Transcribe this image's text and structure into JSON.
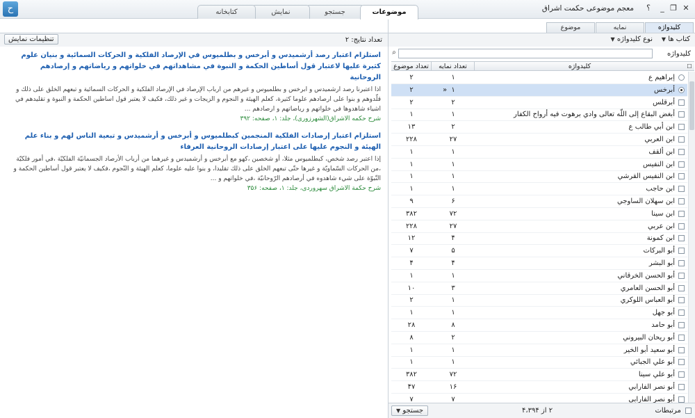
{
  "titlebar": {
    "app_title": "معجم موضوعی حکمت اشراق",
    "help": "؟",
    "logo": "ح",
    "tabs": [
      "کتابخانه",
      "نمایش",
      "جستجو",
      "موضوعات"
    ],
    "active_tab": "موضوعات",
    "buttons": {
      "minimize": "_",
      "restore": "❐",
      "close": "✕"
    }
  },
  "right_panel": {
    "subtabs": [
      "موضوع",
      "نمایه",
      "کلیدواژه"
    ],
    "active_subtab": "کلیدواژه",
    "toolbar": {
      "books": "کتاب ها",
      "keyword_type": "نوع کلیدواژه"
    },
    "search": {
      "label": "کلیدواژه",
      "value": "",
      "placeholder": ""
    },
    "columns": {
      "topic_count": "تعداد موضوع",
      "index_count": "تعداد نمایه",
      "keyword": "کلیدواژه"
    },
    "rows": [
      {
        "kw": "إبراهيم ع",
        "rep": "۱",
        "topic": "۲",
        "sel": false,
        "radio": true
      },
      {
        "kw": "أبرخس",
        "rep": "۱",
        "topic": "۲",
        "sel": true,
        "radio": true
      },
      {
        "kw": "أبرقلس",
        "rep": "۲",
        "topic": "۲",
        "sel": false,
        "radio": false
      },
      {
        "kw": "أبغض البقاع إلى اللّه تعالی وادي برهوت فيه أرواح الكفار",
        "rep": "۱",
        "topic": "۱",
        "sel": false,
        "radio": false
      },
      {
        "kw": "ابن أبي طالب ع",
        "rep": "۲",
        "topic": "۱۳",
        "sel": false,
        "radio": false
      },
      {
        "kw": "ابن العربي",
        "rep": "۲۷",
        "topic": "۲۲۸",
        "sel": false,
        "radio": false
      },
      {
        "kw": "ابن ألقف",
        "rep": "۱",
        "topic": "۱",
        "sel": false,
        "radio": false
      },
      {
        "kw": "ابن النفيس",
        "rep": "۱",
        "topic": "۱",
        "sel": false,
        "radio": false
      },
      {
        "kw": "ابن النفيس القرشي",
        "rep": "۱",
        "topic": "۱",
        "sel": false,
        "radio": false
      },
      {
        "kw": "ابن حاجب",
        "rep": "۱",
        "topic": "۱",
        "sel": false,
        "radio": false
      },
      {
        "kw": "ابن سهلان الساوجي",
        "rep": "۶",
        "topic": "۹",
        "sel": false,
        "radio": false
      },
      {
        "kw": "ابن سينا",
        "rep": "۷۲",
        "topic": "۳۸۲",
        "sel": false,
        "radio": false
      },
      {
        "kw": "ابن عربي",
        "rep": "۲۷",
        "topic": "۲۲۸",
        "sel": false,
        "radio": false
      },
      {
        "kw": "ابن كمونة",
        "rep": "۴",
        "topic": "۱۲",
        "sel": false,
        "radio": false
      },
      {
        "kw": "أبو البركات",
        "rep": "۵",
        "topic": "۷",
        "sel": false,
        "radio": false
      },
      {
        "kw": "أبو البشر",
        "rep": "۴",
        "topic": "۴",
        "sel": false,
        "radio": false
      },
      {
        "kw": "أبو الحسن الخرقاني",
        "rep": "۱",
        "topic": "۱",
        "sel": false,
        "radio": false
      },
      {
        "kw": "أبو الحسن العامري",
        "rep": "۳",
        "topic": "۱۰",
        "sel": false,
        "radio": false
      },
      {
        "kw": "أبو العباس اللوكري",
        "rep": "۱",
        "topic": "۲",
        "sel": false,
        "radio": false
      },
      {
        "kw": "أبو جهل",
        "rep": "۱",
        "topic": "۱",
        "sel": false,
        "radio": false
      },
      {
        "kw": "أبو حامد",
        "rep": "۸",
        "topic": "۲۸",
        "sel": false,
        "radio": false
      },
      {
        "kw": "أبو ريحان البيروني",
        "rep": "۲",
        "topic": "۸",
        "sel": false,
        "radio": false
      },
      {
        "kw": "أبو سعيد أبو الخير",
        "rep": "۱",
        "topic": "۱",
        "sel": false,
        "radio": false
      },
      {
        "kw": "أبو علي الجبائي",
        "rep": "۱",
        "topic": "۱",
        "sel": false,
        "radio": false
      },
      {
        "kw": "أبو علي سينا",
        "rep": "۷۲",
        "topic": "۳۸۲",
        "sel": false,
        "radio": false
      },
      {
        "kw": "أبو نصر الفارابي",
        "rep": "۱۶",
        "topic": "۴۷",
        "sel": false,
        "radio": false
      },
      {
        "kw": "أبو نصر الفارابي",
        "rep": "۷",
        "topic": "۷",
        "sel": false,
        "radio": false
      }
    ],
    "footer": {
      "related": "مرتبطات",
      "page_info": "۲ از ۴،۳۹۴",
      "search_button": "جستجو"
    }
  },
  "left_panel": {
    "display_settings": "تنظیمات نمایش",
    "result_count": "تعداد نتایج: ۲",
    "results": [
      {
        "title": "استلزام اعتبار رصد أرشميدس و أبرخس و بطلميوس في الإرصاد الفلكية و الحركات السمائية و بنيان علوم كثيرة عليها لاعتبار قول أساطين الحكمة و النبوة في مشاهداتهم في خلواتهم و رياضاتهم و إرصادهم الروحانية",
        "body": "اذا اعتبرنا رصد ارشميدس و ابرخس و بطلميوس و غيرهم من ارباب الإرصاد في الإرصاد الفلكية و الحركات السمائية و تبعهم الخلق على ذلك و قلّدوهم و بنوا على ارصادهم علوما كثيرة، كعلم الهيئة و النجوم و الزيجات و غير ذلك، فكيف لا يعتبر قول اساطين الحكمة و النبوة و تقليدهم في اشياء شاهدوها في خلواتهم و رياضاتهم و ارصادهم ...",
        "source": "شرح حکمه الاشراق(الشهرزوری)، جلد: ۱، صفحه: ۳۹۲"
      },
      {
        "title": "استلزام اعتبار إرصادات الفلكية المنجمين كبطلميوس و أبرخس و أرشميدس و تبعية الناس لهم و بناء علم الهيئة و النجوم عليها على اعتبار إرصادات الروحانية العرفاء",
        "body": "إذا اعتبر رصد شخص، كبطلميوس مثلا، أو شخصين ،كهو مع أبرخس و أرشميدس و غيرهما من أرباب الأرصاد الجسمانيّة الفلكيّة ،في أمور فلكيّة ،من الحركات السّماويّة و غيرها حتّى تبعهم الخلق على ذلك تقليدا، و بنوا عليه علوما، كعلم الهيئة و النّجوم ،فكيف لا يعتبر قول أساطين الحكمة و النّبوّة على شيء شاهدوه في أرصادهم الرّوحانيّة ،في خلواتهم و ...",
        "source": "شرح حکمة الاشراق سهروردی، جلد: ۱، صفحه: ۳۵۶"
      }
    ]
  }
}
